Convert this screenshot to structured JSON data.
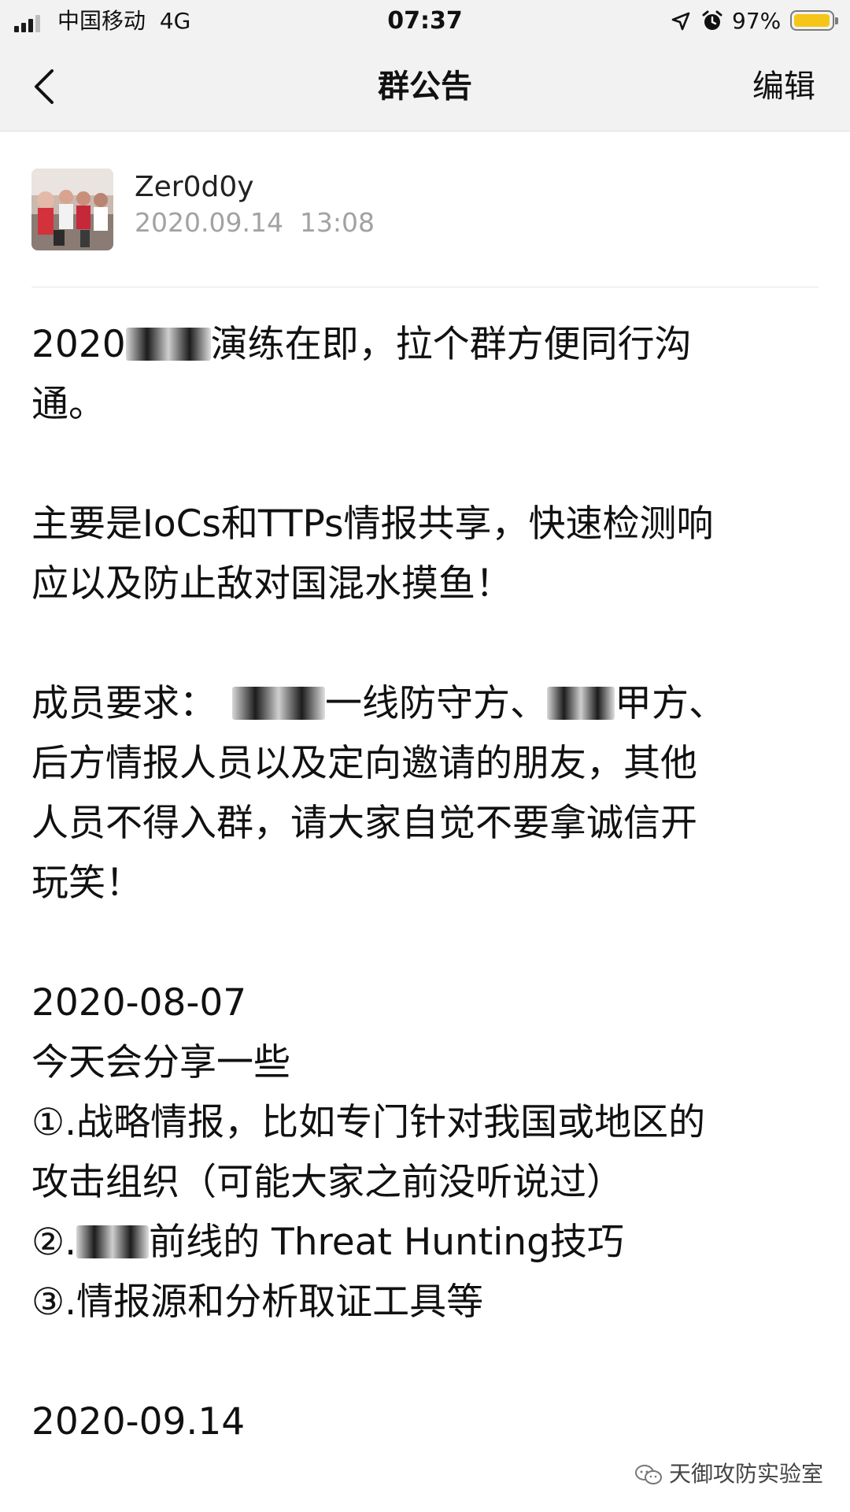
{
  "status_bar": {
    "carrier": "中国移动",
    "network": "4G",
    "time": "07:37",
    "battery_percent": "97%",
    "battery_level": 0.97,
    "battery_color": "#f5c518",
    "icons": [
      "signal-icon",
      "location-arrow-icon",
      "alarm-clock-icon",
      "battery-icon"
    ]
  },
  "nav": {
    "back_icon": "chevron-left-icon",
    "title": "群公告",
    "edit_label": "编辑"
  },
  "post": {
    "author": "Zer0d0y",
    "date": "2020.09.14",
    "time": "13:08",
    "p1": {
      "l1a": "2020",
      "l1b": "演练在即，拉个群方便同行沟",
      "l2": "通。"
    },
    "p2": {
      "l1": "主要是IoCs和TTPs情报共享，快速检测响",
      "l2": "应以及防止敌对国混水摸鱼！"
    },
    "p3": {
      "l1a": "成员要求：",
      "l1b": "一线防守方、",
      "l1c": "甲方、",
      "l2": "后方情报人员以及定向邀请的朋友，其他",
      "l3": "人员不得入群，请大家自觉不要拿诚信开",
      "l4": "玩笑！"
    },
    "p4": {
      "date": "2020-08-07",
      "l1": "今天会分享一些",
      "l2": "①.战略情报，比如专门针对我国或地区的",
      "l3": "攻击组织（可能大家之前没听说过）",
      "l4a": "②.",
      "l4b": "前线的 Threat Hunting技巧",
      "l5": "③.情报源和分析取证工具等"
    },
    "p5": {
      "date": "2020-09.14"
    }
  },
  "watermark": {
    "icon": "wechat-icon",
    "text": "天御攻防实验室"
  }
}
